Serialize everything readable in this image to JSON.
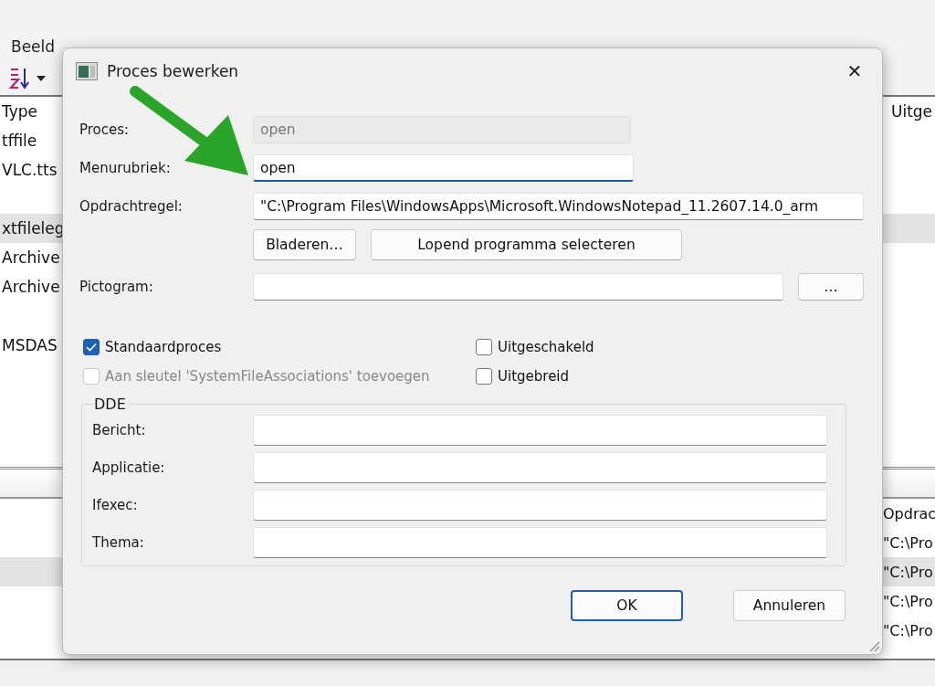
{
  "background_window": {
    "menu": [
      {
        "label": "Beeld"
      }
    ],
    "top_list": {
      "columns": [
        "Type",
        "Uitge"
      ],
      "rows": [
        {
          "text": "tffile",
          "selected": false
        },
        {
          "text": "VLC.tts",
          "selected": false
        },
        {
          "selected": false
        },
        {
          "text": "xtfileleg",
          "selected": true
        },
        {
          "text": "Archive",
          "selected": false
        },
        {
          "text": "Archive",
          "selected": false
        },
        {
          "selected": false
        },
        {
          "text": "MSDAS",
          "selected": false
        }
      ]
    },
    "bottom_list": {
      "column": "Opdrac",
      "rows": [
        {
          "text": "\"C:\\Pro",
          "selected": false
        },
        {
          "text": "\"C:\\Pro",
          "selected": true
        },
        {
          "text": "\"C:\\Pro",
          "selected": false
        },
        {
          "text": "\"C:\\Pro",
          "selected": false
        }
      ]
    }
  },
  "dialog": {
    "title": "Proces bewerken",
    "close": "✕",
    "fields": [
      {
        "label": "Proces:",
        "value": "open",
        "disabled": true,
        "focused": false
      },
      {
        "label": "Menurubriek:",
        "value": "open",
        "disabled": false,
        "focused": true
      },
      {
        "label": "Opdrachtregel:",
        "value": "\"C:\\Program Files\\WindowsApps\\Microsoft.WindowsNotepad_11.2607.14.0_arm",
        "disabled": false,
        "focused": false
      }
    ],
    "command_buttons": [
      {
        "label": "Bladeren…"
      },
      {
        "label": "Lopend programma selecteren"
      }
    ],
    "icon_field": {
      "label": "Pictogram:",
      "button": "…"
    },
    "checkboxes": [
      {
        "label": "Standaardproces",
        "checked": true,
        "disabled": false
      },
      {
        "label": "Uitgeschakeld",
        "checked": false,
        "disabled": false
      },
      {
        "label": "Aan sleutel 'SystemFileAssociations' toevoegen",
        "checked": false,
        "disabled": true
      },
      {
        "label": "Uitgebreid",
        "checked": false,
        "disabled": false
      }
    ],
    "dde": {
      "title": "DDE",
      "fields": [
        {
          "label": "Bericht:"
        },
        {
          "label": "Applicatie:"
        },
        {
          "label": "Ifexec:"
        },
        {
          "label": "Thema:"
        }
      ]
    },
    "footer_buttons": [
      {
        "label": "OK",
        "default": true
      },
      {
        "label": "Annuleren",
        "default": false
      }
    ]
  }
}
